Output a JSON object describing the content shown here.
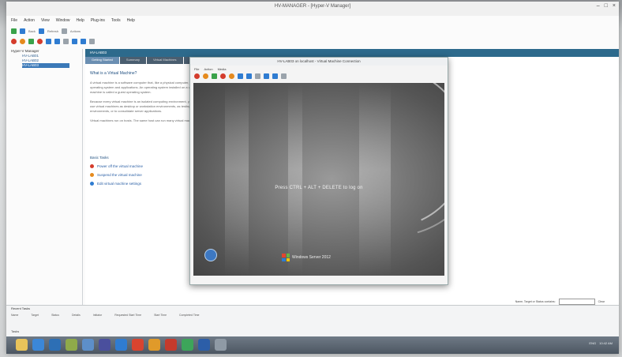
{
  "window": {
    "title": "HV-MANAGER - [Hyper-V Manager]",
    "controls": [
      "–",
      "□",
      "×"
    ]
  },
  "menubar": [
    "File",
    "Action",
    "View",
    "Window",
    "Help",
    "Plug-ins",
    "Tools",
    "Help"
  ],
  "toolbar_text": [
    "Back",
    "Forward",
    "Refresh",
    "Actions"
  ],
  "tree": {
    "root": "Hyper-V Manager",
    "items": [
      "HV-LAB01",
      "HV-LAB02",
      "HV-LAB03"
    ]
  },
  "pane": {
    "header": "HV-LAB03",
    "tabs": [
      "Getting Started",
      "Summary",
      "Virtual Machines",
      "Hosts"
    ]
  },
  "info": {
    "heading": "What is a Virtual Machine?",
    "paragraphs": [
      "A virtual machine is a software computer that, like a physical computer, runs an operating system and applications. An operating system installed on a virtual machine is called a guest operating system.",
      "Because every virtual machine is an isolated computing environment, you can use virtual machines as desktop or workstation environments, as testing environments, or to consolidate server applications.",
      "Virtual machines run on hosts. The same host can run many virtual machines."
    ]
  },
  "basic_tasks": {
    "heading": "Basic Tasks",
    "items": [
      "Power off the virtual machine",
      "Suspend the virtual machine",
      "Edit virtual machine settings"
    ],
    "colors": [
      "#d43c2c",
      "#e58a1d",
      "#2f7cd1"
    ]
  },
  "vm": {
    "title": "HV-LAB03 on localhost - Virtual Machine Connection",
    "menu": [
      "File",
      "Action",
      "Media",
      "View",
      "Help"
    ],
    "screen_message": "Press CTRL + ALT + DELETE to log on",
    "logo_text": "Windows Server 2012"
  },
  "bottom": {
    "label": "Recent Tasks",
    "filter_label": "Name, Target or Status contains:",
    "clear": "Clear",
    "columns": [
      "Name",
      "Target",
      "Status",
      "Details",
      "Initiator",
      "Requested Start Time",
      "Start Time",
      "Completed Time"
    ],
    "status": "Tasks"
  },
  "tray": {
    "lang": "ENG",
    "time": "10:42 AM"
  }
}
